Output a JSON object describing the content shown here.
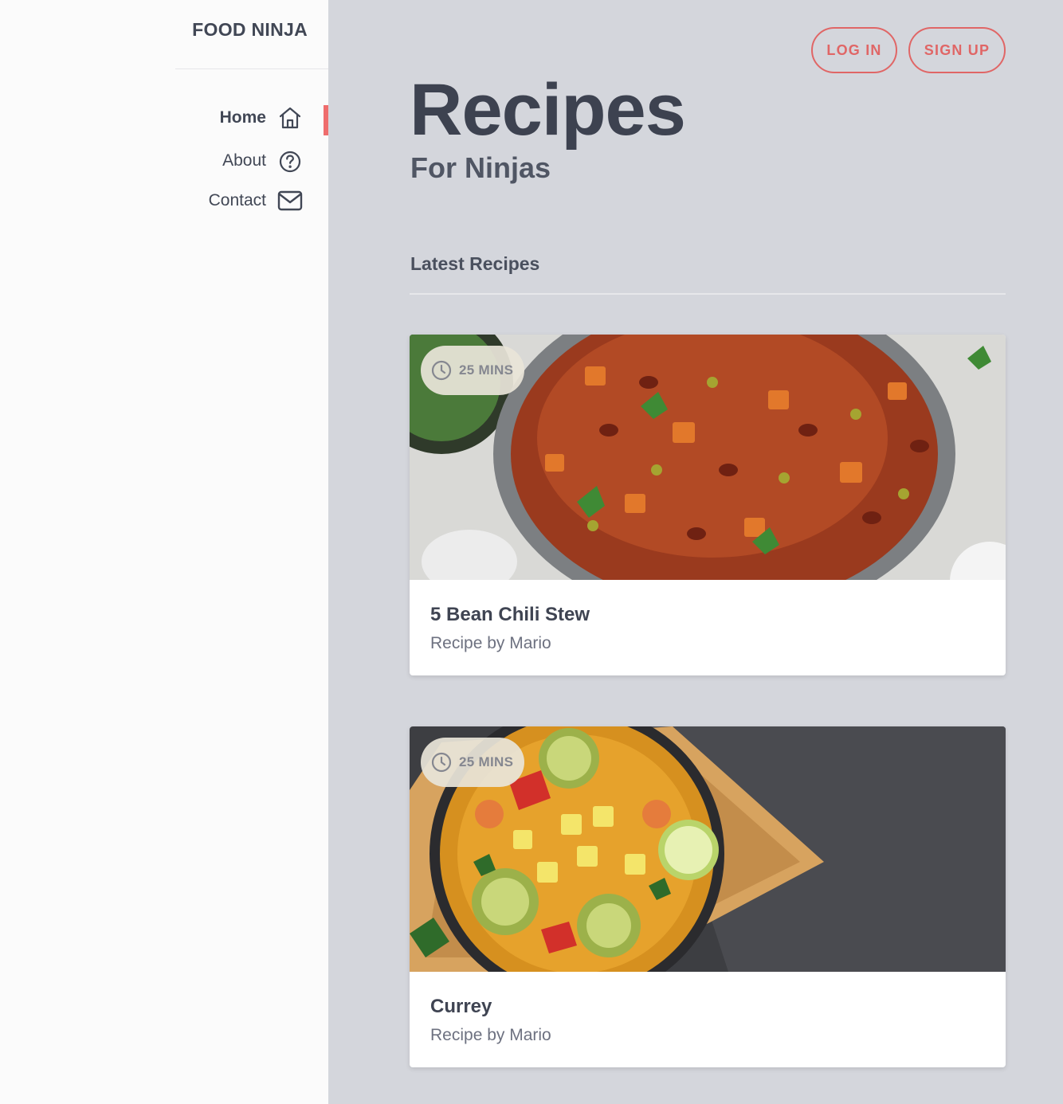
{
  "app": {
    "brand": "FOOD NINJA"
  },
  "sidebar": {
    "items": [
      {
        "label": "Home",
        "icon": "home-icon",
        "active": true
      },
      {
        "label": "About",
        "icon": "question-circle-icon",
        "active": false
      },
      {
        "label": "Contact",
        "icon": "envelope-icon",
        "active": false
      }
    ]
  },
  "header": {
    "login_label": "LOG IN",
    "signup_label": "SIGN UP"
  },
  "hero": {
    "title": "Recipes",
    "subtitle": "For Ninjas"
  },
  "main": {
    "section_title": "Latest Recipes",
    "recipes": [
      {
        "time": "25 MINS",
        "title": "5 Bean Chili Stew",
        "byline": "Recipe by Mario",
        "image": "bean-chili-stew-photo"
      },
      {
        "time": "25 MINS",
        "title": "Currey",
        "byline": "Recipe by Mario",
        "image": "curry-bowl-photo"
      }
    ]
  },
  "colors": {
    "accent": "#ef6d6d",
    "page_bg": "#d4d6dc",
    "sidebar_bg": "#fbfbfb",
    "text": "#3f4452"
  }
}
